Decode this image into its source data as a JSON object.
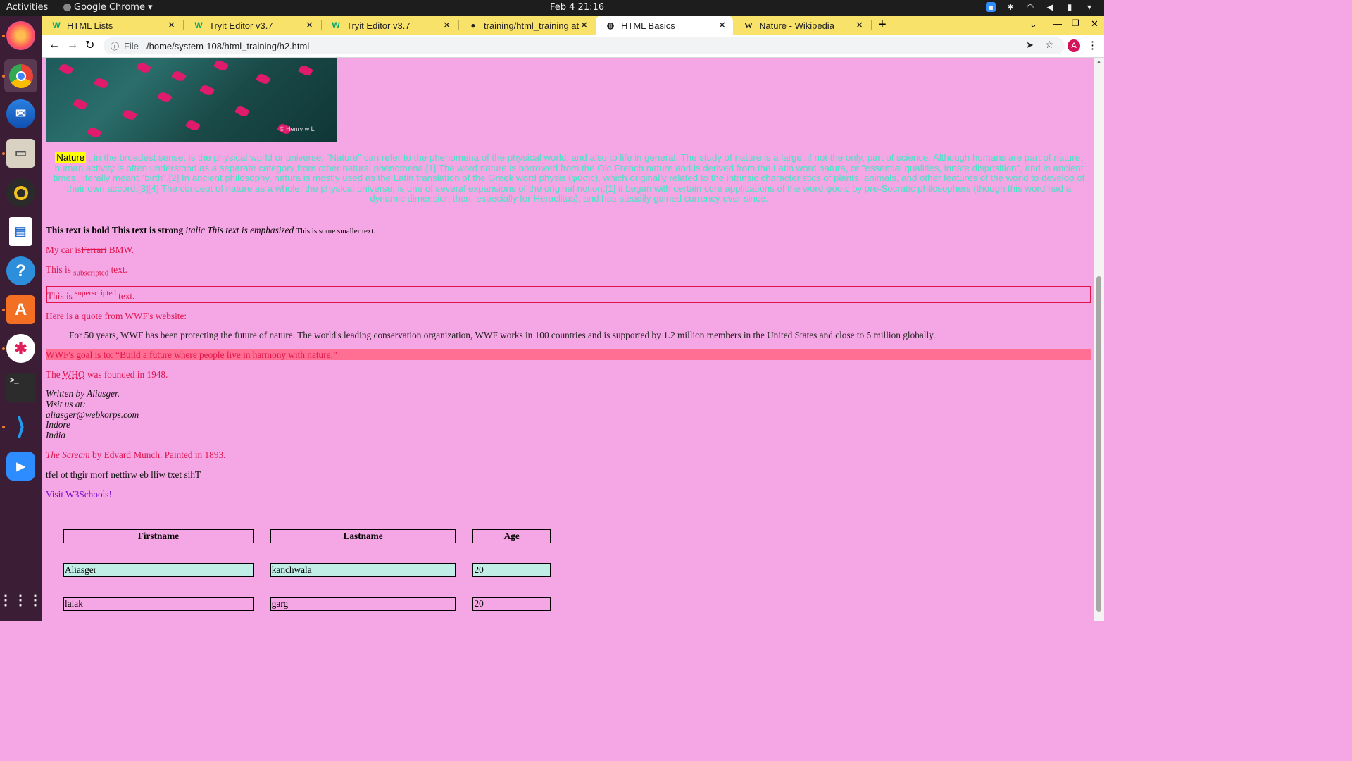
{
  "topbar": {
    "activities": "Activities",
    "app_name": "Google Chrome",
    "clock": "Feb 4  21:16"
  },
  "dock": {
    "items": [
      "firefox-icon",
      "chrome-icon",
      "thunderbird-icon",
      "files-icon",
      "rhythmbox-icon",
      "libreoffice-writer-icon",
      "help-icon",
      "software-center-icon",
      "slack-icon",
      "terminal-icon",
      "vscode-icon",
      "zoom-icon",
      "show-apps-icon"
    ]
  },
  "tabs": [
    {
      "title": "HTML Lists",
      "favicon": "W"
    },
    {
      "title": "Tryit Editor v3.7",
      "favicon": "W"
    },
    {
      "title": "Tryit Editor v3.7",
      "favicon": "W"
    },
    {
      "title": "training/html_training at",
      "favicon": "github"
    },
    {
      "title": "HTML Basics",
      "favicon": "globe"
    },
    {
      "title": "Nature - Wikipedia",
      "favicon": "W"
    }
  ],
  "toolbar": {
    "file_label": "File",
    "url": "/home/system-108/html_training/h2.html",
    "avatar": "A"
  },
  "page": {
    "image_caption": "© Henry w L",
    "nature_word": "Nature",
    "nature_text": " , in the broadest sense, is the physical world or universe. \"Nature\" can refer to the phenomena of the physical world, and also to life in general. The study of nature is a large, if not the only, part of science. Although humans are part of nature, human activity is often understood as a separate category from other natural phenomena.[1] The word nature is borrowed from the Old French nature and is derived from the Latin word natura, or \"essential qualities, innate disposition\", and in ancient times, literally meant \"birth\".[2] In ancient philosophy, natura is mostly used as the Latin translation of the Greek word physis (φύσις), which originally related to the intrinsic characteristics of plants, animals, and other features of the world to develop of their own accord.[3][4] The concept of nature as a whole, the physical universe, is one of several expansions of the original notion;[1] it began with certain core applications of the word φύσις by pre-Socratic philosophers (though this word had a dynamic dimension then, especially for Heraclitus), and has steadily gained currency ever since.",
    "bold": "This text is bold",
    "strong": "This text is strong",
    "italic": "italic",
    "em": "This text is emphasized",
    "small": "This is some smaller text.",
    "car_prefix": "My car is",
    "car_del": "Ferrari",
    "car_ins": " BMW",
    "car_end": ".",
    "sub_prefix": "This is ",
    "sub_text": "subscripted",
    "sub_end": " text.",
    "sup_prefix": "This is ",
    "sup_text": "superscripted",
    "sup_end": " text.",
    "quote_intro": "Here is a quote from WWF's website:",
    "blockquote": "For 50 years, WWF has been protecting the future of nature. The world's leading conservation organization, WWF works in 100 countries and is supported by 1.2 million members in the United States and close to 5 million globally.",
    "goal": "WWF's goal is to: “Build a future where people live in harmony with nature.”",
    "who_prefix": "The ",
    "who_abbr": "WHO",
    "who_end": " was founded in 1948.",
    "address": [
      "Written by Aliasger.",
      "Visit us at:",
      "aliasger@webkorps.com",
      "Indore",
      "India"
    ],
    "scream_title": "The Scream",
    "scream_rest": " by Edvard Munch. Painted in 1893.",
    "bdo": "tfel ot thgir morf nettirw eb lliw txet sihT",
    "link": "Visit W3Schools!",
    "table": {
      "headers": [
        "Firstname",
        "Lastname",
        "Age"
      ],
      "rows": [
        [
          "Aliasger",
          "kanchwala",
          "20"
        ],
        [
          "lalak",
          "garg",
          "20"
        ]
      ]
    }
  }
}
